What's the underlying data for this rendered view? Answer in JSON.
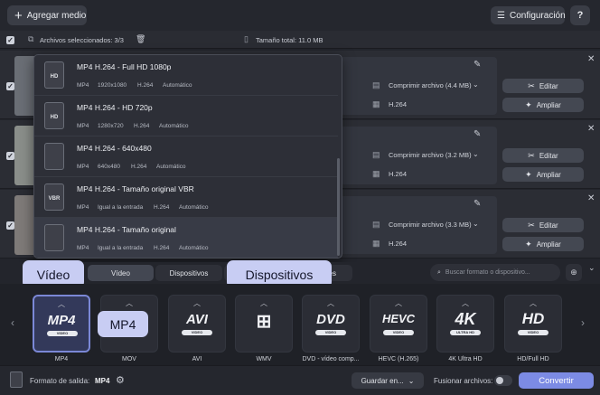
{
  "topbar": {
    "add_label": "Agregar medio",
    "config_label": "Configuración",
    "help_label": "?"
  },
  "selection": {
    "selected_label": "Archivos seleccionados: 3/3",
    "total_label": "Tamaño total: 11.0 MB"
  },
  "files": [
    {
      "compress": "Comprimir archivo (4.4 MB)",
      "codec": "H.264"
    },
    {
      "compress": "Comprimir archivo (3.2 MB)",
      "codec": "H.264"
    },
    {
      "compress": "Comprimir archivo (3.3 MB)",
      "codec": "H.264"
    }
  ],
  "file_actions": {
    "edit": "Editar",
    "enhance": "Ampliar"
  },
  "presets": [
    {
      "title": "MP4 H.264 - Full HD 1080p",
      "icon": "HD",
      "meta": [
        "MP4",
        "1920x1080",
        "H.264",
        "Automático"
      ]
    },
    {
      "title": "MP4 H.264 - HD 720p",
      "icon": "HD",
      "meta": [
        "MP4",
        "1280x720",
        "H.264",
        "Automático"
      ]
    },
    {
      "title": "MP4 H.264 - 640x480",
      "icon": "",
      "meta": [
        "MP4",
        "640x480",
        "H.264",
        "Automático"
      ]
    },
    {
      "title": "MP4 H.264 - Tamaño original VBR",
      "icon": "VBR",
      "meta": [
        "MP4",
        "Igual a la entrada",
        "H.264",
        "Automático"
      ]
    },
    {
      "title": "MP4 H.264 - Tamaño original",
      "icon": "",
      "meta": [
        "MP4",
        "Igual a la entrada",
        "H.264",
        "Automático"
      ]
    }
  ],
  "tabs": {
    "video": "Vídeo",
    "devices": "Dispositivos",
    "tab3_suffix": "es"
  },
  "bubbles": {
    "video": "Vídeo",
    "devices": "Dispositivos",
    "mp4": "MP4"
  },
  "search_placeholder": "Buscar formato o dispositivo...",
  "formats": [
    {
      "logo": "MP4",
      "sub": "VIDEO",
      "label": "MP4"
    },
    {
      "logo": "",
      "sub": "",
      "label": "MOV"
    },
    {
      "logo": "AVI",
      "sub": "VIDEO",
      "label": "AVI"
    },
    {
      "logo": "",
      "sub": "",
      "label": "WMV"
    },
    {
      "logo": "DVD",
      "sub": "VIDEO",
      "label": "DVD - vídeo comp..."
    },
    {
      "logo": "HEVC",
      "sub": "VIDEO",
      "label": "HEVC (H.265)"
    },
    {
      "logo": "4K",
      "sub": "ULTRA HD",
      "label": "4K Ultra HD"
    },
    {
      "logo": "HD",
      "sub": "VIDEO",
      "label": "HD/Full HD"
    }
  ],
  "bottom": {
    "output_label": "Formato de salida:",
    "output_value": "MP4",
    "save_label": "Guardar en...",
    "merge_label": "Fusionar archivos:",
    "convert_label": "Convertir"
  },
  "colors": {
    "accent": "#7c8be4",
    "bubble": "#c8cdf3"
  }
}
